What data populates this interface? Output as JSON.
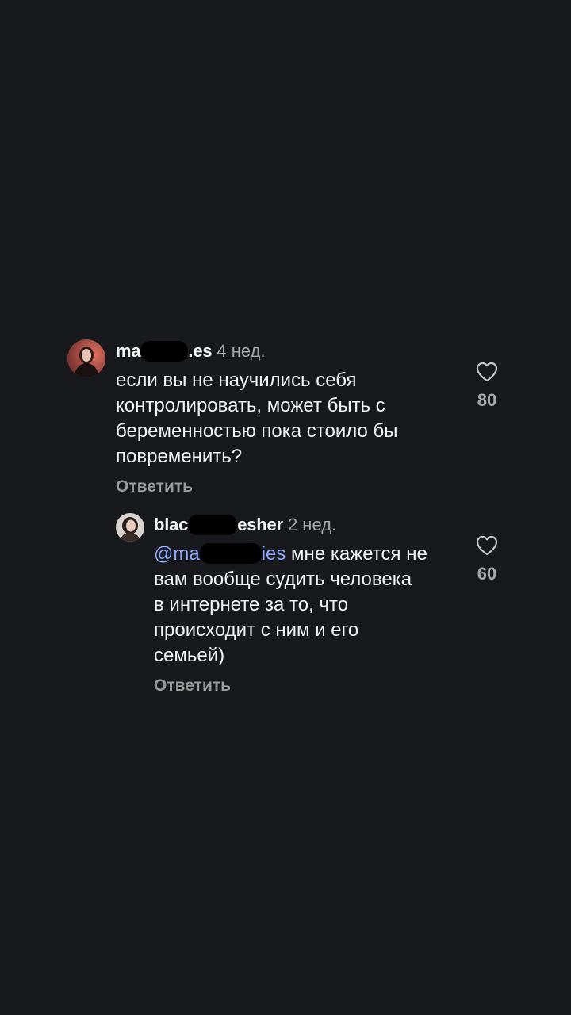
{
  "comments": [
    {
      "username_start": "ma",
      "username_end": ".es",
      "time": "4 нед.",
      "text_lines": [
        "если вы не научились себя",
        "контролировать, может быть с",
        "беременностью пока стоило бы",
        "повременить?"
      ],
      "likes": "80",
      "reply_label": "Ответить"
    },
    {
      "username_start": "blac",
      "username_end": "esher",
      "time": "2 нед.",
      "mention_start": "@ma",
      "mention_end": "ies",
      "text_lines": [
        " мне кажется не",
        "вам вообще судить человека",
        "в интернете за то, что",
        "происходит с ним и его",
        "семьей)"
      ],
      "likes": "60",
      "reply_label": "Ответить"
    }
  ],
  "colors": {
    "background": "#17191c",
    "mention": "#8ea7ff",
    "secondary_text": "#a8a8a8"
  },
  "icons": {
    "like": "heart-outline-icon"
  }
}
